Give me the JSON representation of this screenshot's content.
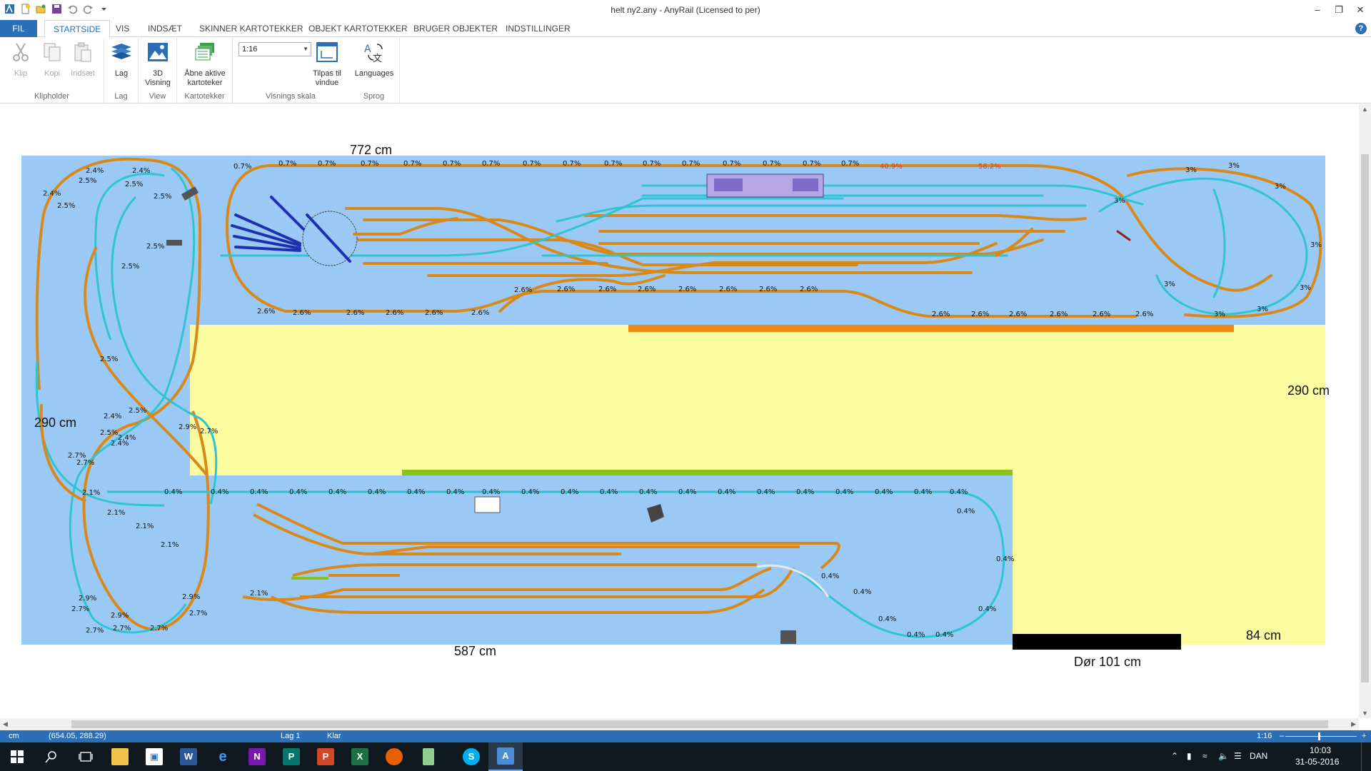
{
  "window": {
    "title": "helt ny2.any - AnyRail (Licensed to per)",
    "controls": [
      "minimize",
      "restore",
      "close"
    ]
  },
  "tabs": [
    {
      "label": "FIL"
    },
    {
      "label": "STARTSIDE",
      "active": true
    },
    {
      "label": "VIS"
    },
    {
      "label": "INDSÆT"
    },
    {
      "label": "SKINNER KARTOTEKKER"
    },
    {
      "label": "OBJEKT KARTOTEKKER"
    },
    {
      "label": "BRUGER OBJEKTER"
    },
    {
      "label": "INDSTILLINGER"
    }
  ],
  "ribbon": {
    "clipboard": {
      "group": "Klipholder",
      "cut": "Klip",
      "copy": "Kopi",
      "paste": "Indsæt"
    },
    "layers": {
      "group": "Lag",
      "button": "Lag"
    },
    "view": {
      "group": "View",
      "button_line1": "3D",
      "button_line2": "Visning"
    },
    "catalogs": {
      "group": "Kartotekker",
      "button_line1": "Åbne aktive",
      "button_line2": "kartoteker"
    },
    "scale": {
      "group": "Visnings skala",
      "value": "1:16",
      "fit_line1": "Tilpas til",
      "fit_line2": "vindue"
    },
    "language": {
      "group": "Sprog",
      "button": "Languages"
    }
  },
  "canvas": {
    "dimensions": {
      "top": "772 cm",
      "left": "290 cm",
      "right": "290 cm",
      "bottom": "587 cm",
      "corner": "84 cm",
      "door": "Dør 101 cm"
    },
    "grade_labels": {
      "upper_main": "0.7%",
      "upper_lower": "2.6%",
      "loop_right": "3%",
      "figure8": "2.5%",
      "figure8b": "2.4%",
      "lower_main": "0.4%",
      "lower_left": "2.7%",
      "lower_left_b": "2.9%",
      "lower_left_c": "2.1%",
      "warning_a": "40.9%",
      "warning_b": "58.2%"
    },
    "colors": {
      "board": "#9bc9f5",
      "room_floor": "#fbfba0",
      "track_brown": "#d8891a",
      "track_cyan": "#2ec4d4",
      "warning": "#e53935",
      "shelf_orange": "#ef8a12",
      "shelf_green": "#8bc31a",
      "door": "#000000"
    }
  },
  "statusbar": {
    "units": "cm",
    "coords": "(654.05, 288.29)",
    "layer": "Lag 1",
    "state": "Klar",
    "scale": "1:16",
    "zoom_minus": "–",
    "zoom_plus": "+"
  },
  "taskbar": {
    "apps": [
      "start",
      "search",
      "task-view",
      "file-explorer",
      "store",
      "word",
      "edge",
      "onenote",
      "publisher",
      "powerpoint",
      "excel",
      "firefox",
      "app-green",
      "skype",
      "anyrail"
    ],
    "language": "DAN",
    "time": "10:03",
    "date": "31-05-2016"
  }
}
